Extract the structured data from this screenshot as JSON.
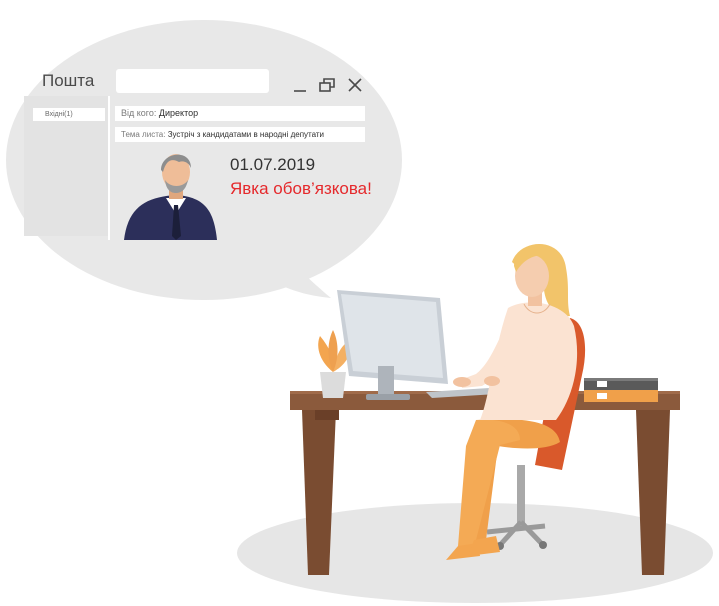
{
  "mail": {
    "app_title": "Пошта",
    "inbox_label": "Вхідні(1)",
    "from_label": "Від кого:",
    "from_value": "Директор",
    "subject_label": "Тема листа:",
    "subject_value": "Зустріч з кандидатами в народні депутати",
    "date": "01.07.2019",
    "notice": "Явка обов’язкова!"
  },
  "colors": {
    "bubble": "#e8e8e8",
    "notice": "#e5292c",
    "desk": "#8b5a3c",
    "blouse": "#fbe3d2",
    "pants": "#f0a04a",
    "chair": "#d9592b"
  },
  "icons": [
    "minimize-icon",
    "restore-icon",
    "close-icon"
  ]
}
